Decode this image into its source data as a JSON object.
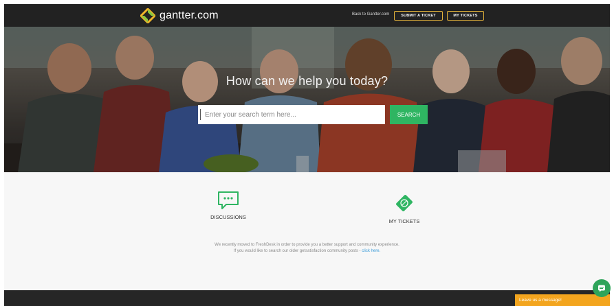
{
  "header": {
    "logo_text": "gantter.com",
    "back_link": "Back to Gantter.com",
    "submit_ticket": "SUBMIT A TICKET",
    "my_tickets": "MY TICKETS"
  },
  "hero": {
    "title": "How can we help you today?",
    "search_placeholder": "Enter your search term here...",
    "search_button": "SEARCH"
  },
  "features": [
    {
      "label": "DISCUSSIONS",
      "icon": "chat-icon"
    },
    {
      "label": "MY TICKETS",
      "icon": "ticket-icon"
    }
  ],
  "notice": {
    "line1": "We recently moved to FreshDesk in order to provide you a better support and community experience.",
    "line2_prefix": "If you would like to search our older getsatisfaction community posts - ",
    "link_text": "click here."
  },
  "chat": {
    "label": "Leave us a message!"
  },
  "colors": {
    "header_bg": "#222222",
    "button_border": "#e2b23b",
    "accent_green": "#2fb562",
    "chat_orange": "#f3a51e"
  }
}
